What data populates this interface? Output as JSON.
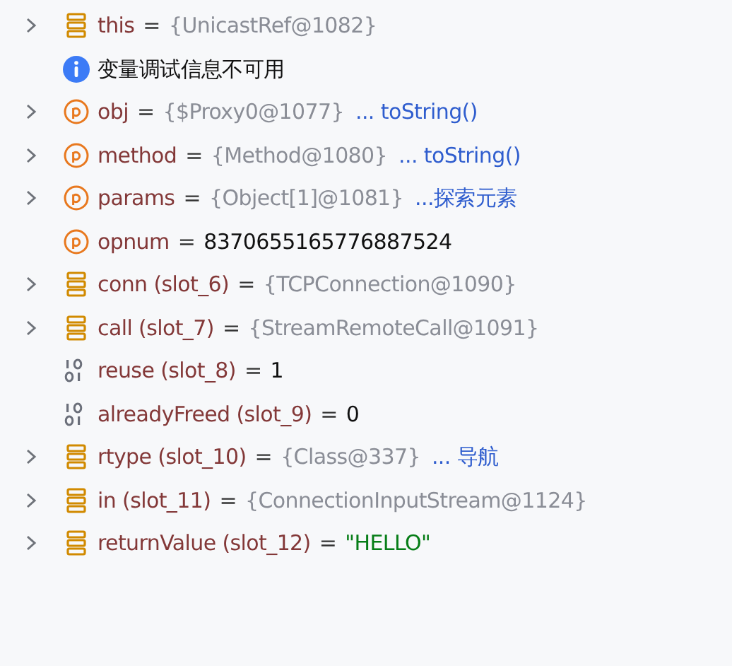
{
  "rows": [
    {
      "kind": "field",
      "expandable": true,
      "name": "this",
      "op": "=",
      "value": {
        "kind": "object",
        "text": "{UnicastRef@1082}"
      }
    },
    {
      "kind": "info",
      "expandable": false,
      "text": "变量调试信息不可用"
    },
    {
      "kind": "param",
      "expandable": true,
      "name": "obj",
      "op": "=",
      "value": {
        "kind": "object",
        "text": "{$Proxy0@1077}"
      },
      "link": "... toString()"
    },
    {
      "kind": "param",
      "expandable": true,
      "name": "method",
      "op": "=",
      "value": {
        "kind": "object",
        "text": "{Method@1080}"
      },
      "link": "... toString()"
    },
    {
      "kind": "param",
      "expandable": true,
      "name": "params",
      "op": "=",
      "value": {
        "kind": "object",
        "text": "{Object[1]@1081}"
      },
      "link": "...探索元素"
    },
    {
      "kind": "param",
      "expandable": false,
      "name": "opnum",
      "op": "=",
      "value": {
        "kind": "primitive",
        "text": "8370655165776887524"
      }
    },
    {
      "kind": "field",
      "expandable": true,
      "name": "conn (slot_6)",
      "op": "=",
      "value": {
        "kind": "object",
        "text": "{TCPConnection@1090}"
      }
    },
    {
      "kind": "field",
      "expandable": true,
      "name": "call (slot_7)",
      "op": "=",
      "value": {
        "kind": "object",
        "text": "{StreamRemoteCall@1091}"
      }
    },
    {
      "kind": "primitive",
      "expandable": false,
      "name": "reuse (slot_8)",
      "op": "=",
      "value": {
        "kind": "primitive",
        "text": "1"
      }
    },
    {
      "kind": "primitive",
      "expandable": false,
      "name": "alreadyFreed (slot_9)",
      "op": "=",
      "value": {
        "kind": "primitive",
        "text": "0"
      }
    },
    {
      "kind": "field",
      "expandable": true,
      "name": "rtype (slot_10)",
      "op": "=",
      "value": {
        "kind": "object",
        "text": "{Class@337}"
      },
      "link": "... 导航"
    },
    {
      "kind": "field",
      "expandable": true,
      "name": "in (slot_11)",
      "op": "=",
      "value": {
        "kind": "object",
        "text": "{ConnectionInputStream@1124}"
      }
    },
    {
      "kind": "field",
      "expandable": true,
      "name": "returnValue (slot_12)",
      "op": "=",
      "value": {
        "kind": "string",
        "text": "\"HELLO\""
      }
    }
  ]
}
